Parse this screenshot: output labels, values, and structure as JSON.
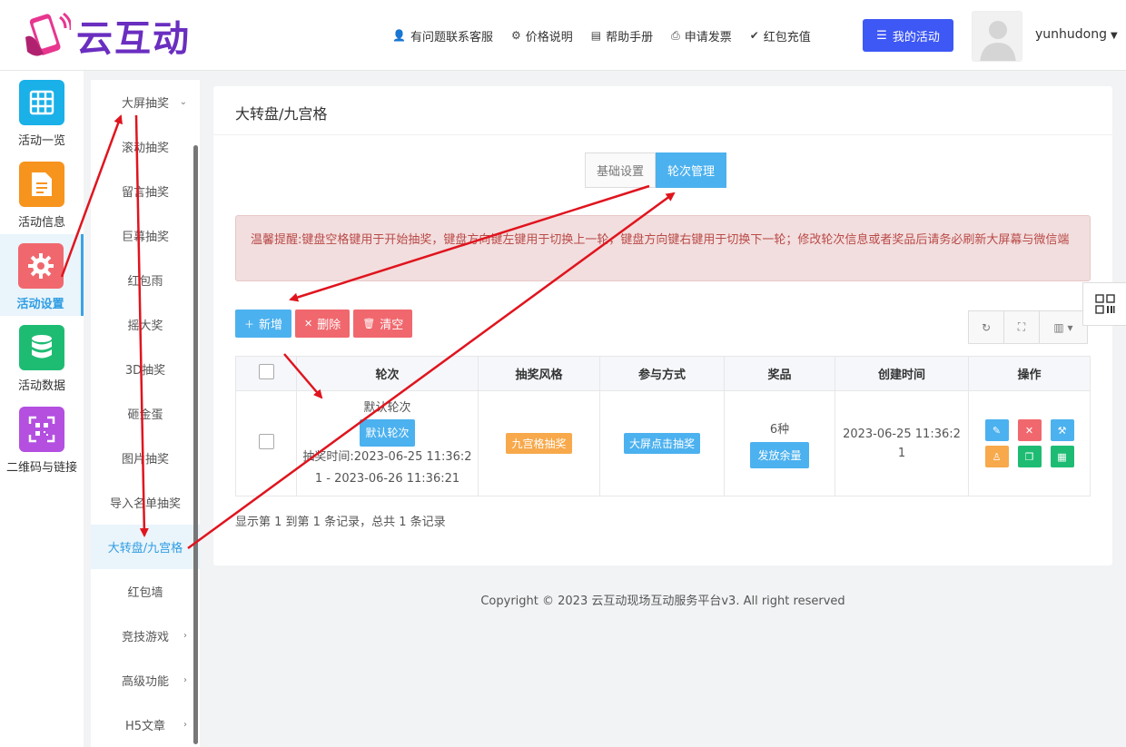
{
  "brand": {
    "name": "云互动"
  },
  "topnav": [
    {
      "icon": "user-plus-icon",
      "glyph": "👤",
      "label": "有问题联系客服"
    },
    {
      "icon": "gear-icon",
      "glyph": "⚙",
      "label": "价格说明"
    },
    {
      "icon": "book-icon",
      "glyph": "▤",
      "label": "帮助手册"
    },
    {
      "icon": "printer-icon",
      "glyph": "⎙",
      "label": "申请发票"
    },
    {
      "icon": "shield-check-icon",
      "glyph": "✔",
      "label": "红包充值"
    }
  ],
  "my_activity": {
    "label": "我的活动"
  },
  "user": {
    "name": "yunhudong"
  },
  "rail": [
    {
      "label": "活动一览",
      "color": "#1ab0e8"
    },
    {
      "label": "活动信息",
      "color": "#f7941d"
    },
    {
      "label": "活动设置",
      "color": "#f0686e"
    },
    {
      "label": "活动数据",
      "color": "#1ebc73"
    },
    {
      "label": "二维码与链接",
      "color": "#b44fe0"
    }
  ],
  "submenu": [
    "大屏抽奖",
    "滚动抽奖",
    "留言抽奖",
    "巨幕抽奖",
    "红包雨",
    "摇大奖",
    "3D抽奖",
    "砸金蛋",
    "图片抽奖",
    "导入名单抽奖",
    "大转盘/九宫格",
    "红包墙",
    "竞技游戏",
    "高级功能",
    "H5文章"
  ],
  "panel": {
    "title": "大转盘/九宫格",
    "tabs": [
      "基础设置",
      "轮次管理"
    ],
    "alert": "温馨提醒:键盘空格键用于开始抽奖，键盘方向键左键用于切换上一轮，键盘方向键右键用于切换下一轮；修改轮次信息或者奖品后请务必刷新大屏幕与微信端",
    "buttons": {
      "add": "新增",
      "delete": "删除",
      "clear": "清空"
    },
    "table": {
      "headers": [
        "轮次",
        "抽奖风格",
        "参与方式",
        "奖品",
        "创建时间",
        "操作"
      ],
      "rows": [
        {
          "round_name": "默认轮次",
          "round_tag": "默认轮次",
          "time_line1": "抽奖时间:2023-06-25 11:36:2",
          "time_line2": "1 - 2023-06-26 11:36:21",
          "style": "九宫格抽奖",
          "mode": "大屏点击抽奖",
          "prize_count": "6种",
          "prize_btn": "发放余量",
          "created_line1": "2023-06-25 11:36:2",
          "created_line2": "1"
        }
      ]
    },
    "records": "显示第 1 到第 1 条记录，总共 1 条记录"
  },
  "copyright": "Copyright © 2023 云互动现场互动服务平台v3. All right reserved",
  "colors": {
    "primary": "#3e58f5",
    "accent": "#4cb1ef",
    "danger": "#f0686e",
    "arrow": "#e0141e"
  }
}
